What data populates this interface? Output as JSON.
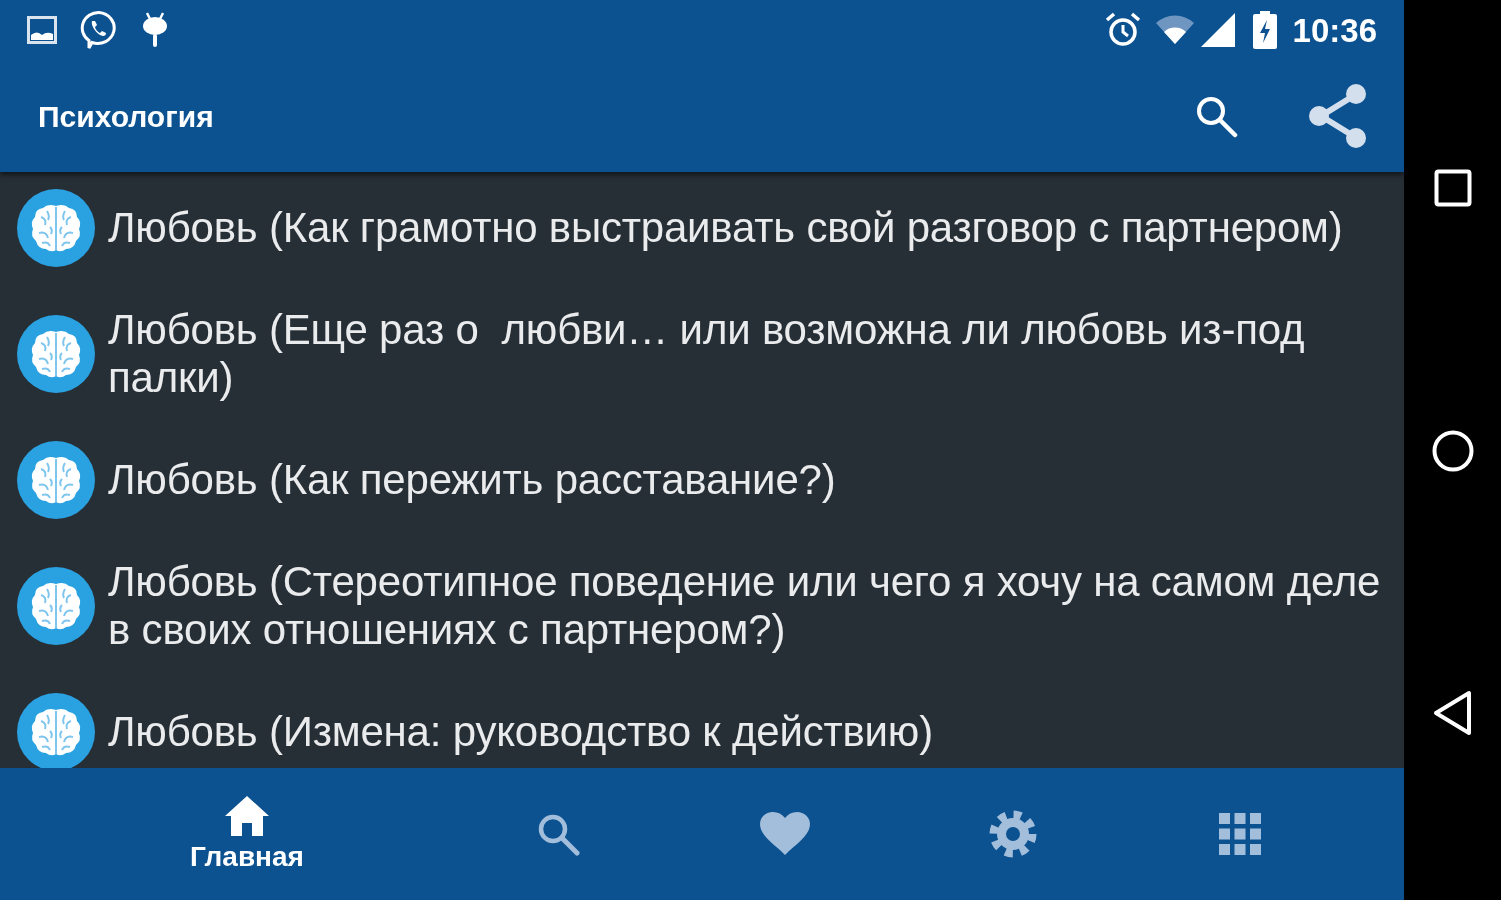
{
  "status_bar": {
    "time": "10:36"
  },
  "app_bar": {
    "title": "Психология"
  },
  "list": {
    "items": [
      {
        "title": "Любовь (Как грамотно выстраивать свой разговор с партнером)"
      },
      {
        "title": "Любовь (Еще раз о  любви… или возможна ли любовь из-под палки)"
      },
      {
        "title": "Любовь (Как пережить расставание?)"
      },
      {
        "title": "Любовь (Стереотипное поведение или чего я хочу на самом деле в своих отношениях с партнером?)"
      },
      {
        "title": "Любовь (Измена: руководство к действию)"
      }
    ]
  },
  "bottom_nav": {
    "items": [
      {
        "label": "Главная",
        "selected": true
      },
      {
        "selected": false
      },
      {
        "selected": false
      },
      {
        "selected": false
      },
      {
        "selected": false
      }
    ]
  }
}
